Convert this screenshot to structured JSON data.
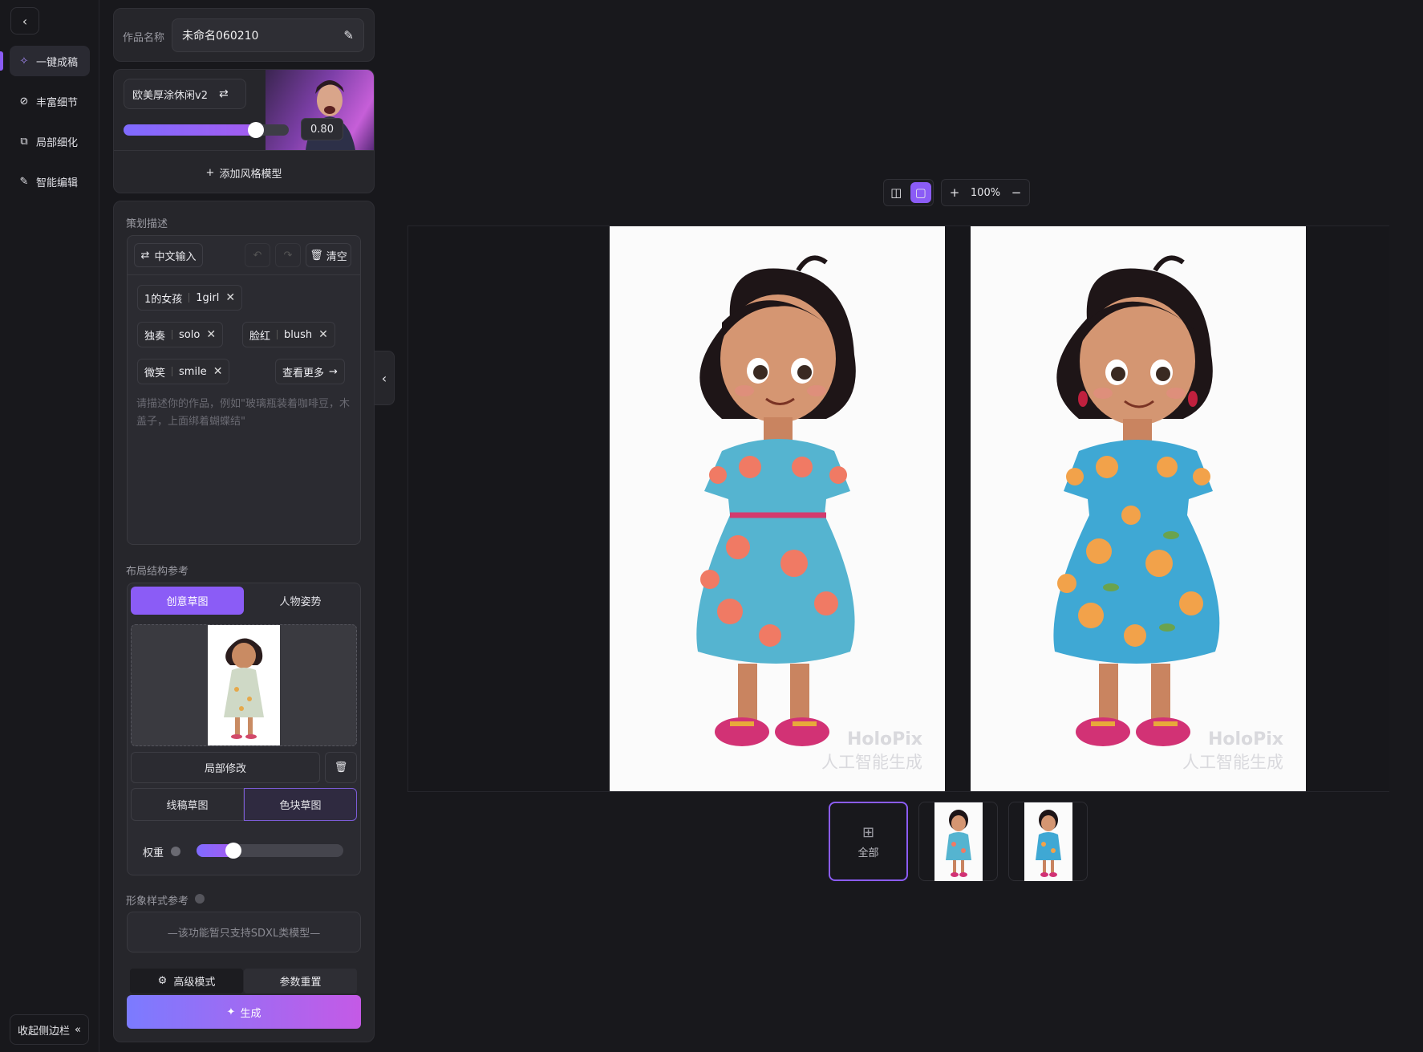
{
  "sidebar": {
    "back_icon": "chevron-left-icon",
    "items": [
      {
        "label": "一键成稿",
        "icon": "sparkle-icon",
        "active": true
      },
      {
        "label": "丰富细节",
        "icon": "detail-icon",
        "active": false
      },
      {
        "label": "局部细化",
        "icon": "region-icon",
        "active": false
      },
      {
        "label": "智能编辑",
        "icon": "pen-icon",
        "active": false
      }
    ],
    "collapse_label": "收起侧边栏"
  },
  "work": {
    "label": "作品名称",
    "name": "未命名060210"
  },
  "style_model": {
    "name": "欧美厚涂休闲v2",
    "weight": "0.80",
    "weight_value": 0.8,
    "add_label": "添加风格模型"
  },
  "prompt": {
    "section_label": "策划描述",
    "input_mode": "中文输入",
    "clear_label": "清空",
    "tags": [
      {
        "zh": "1的女孩",
        "en": "1girl"
      },
      {
        "zh": "独奏",
        "en": "solo"
      },
      {
        "zh": "脸红",
        "en": "blush"
      },
      {
        "zh": "微笑",
        "en": "smile"
      }
    ],
    "more_label": "查看更多",
    "placeholder": "请描述你的作品，例如\"玻璃瓶装着咖啡豆，木盖子，上面绑着蝴蝶结\""
  },
  "layout_ref": {
    "section_label": "布局结构参考",
    "tabs": [
      "创意草图",
      "人物姿势"
    ],
    "active_tab": "创意草图",
    "local_edit": "局部修改",
    "sketch_modes": [
      "线稿草图",
      "色块草图"
    ],
    "active_mode": "色块草图",
    "weight_label": "权重",
    "weight_value": 0.25
  },
  "style_ref": {
    "section_label": "形象样式参考",
    "notice": "—该功能暂只支持SDXL类模型—"
  },
  "actions": {
    "advanced": "高级模式",
    "reset": "参数重置",
    "generate": "生成"
  },
  "canvas": {
    "zoom": "100%",
    "watermark_brand": "HoloPix",
    "watermark_text": "人工智能生成",
    "thumbs": {
      "all_label": "全部"
    }
  },
  "colors": {
    "accent": "#8b5cf6",
    "bg": "#18181c",
    "panel": "#26262b",
    "generate_from": "#7b7bff",
    "generate_to": "#c45ae6"
  }
}
